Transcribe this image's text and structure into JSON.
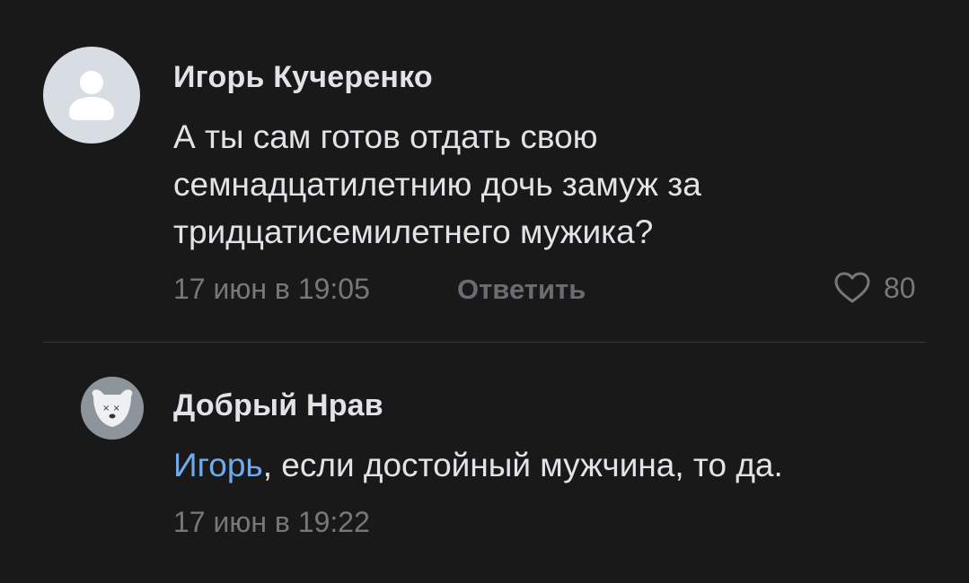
{
  "comments": [
    {
      "author": "Игорь Кучеренко",
      "text_lines": [
        "А ты сам готов отдать свою",
        "семнадцатилетнию дочь замуж за",
        "тридцатисемилетнего мужика?"
      ],
      "date": "17 июн в 19:05",
      "reply_label": "Ответить",
      "likes": "80"
    },
    {
      "author": "Добрый Нрав",
      "mention": "Игорь",
      "text": ", если достойный мужчина, то да.",
      "date": "17 июн в 19:22"
    }
  ],
  "colors": {
    "background": "#19191a",
    "text": "#e1e3e6",
    "secondary": "#76787a",
    "link": "#71aaeb",
    "avatar_placeholder": "#d8dde4"
  }
}
